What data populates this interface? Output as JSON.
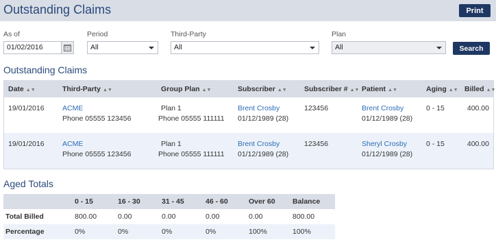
{
  "header": {
    "title": "Outstanding Claims",
    "print_label": "Print"
  },
  "filters": {
    "as_of": {
      "label": "As of",
      "value": "01/02/2016"
    },
    "period": {
      "label": "Period",
      "value": "All"
    },
    "third_party": {
      "label": "Third-Party",
      "value": "All"
    },
    "plan": {
      "label": "Plan",
      "value": "All"
    },
    "search_label": "Search"
  },
  "claims": {
    "title": "Outstanding Claims",
    "columns": [
      "Date",
      "Third-Party",
      "Group Plan",
      "Subscriber",
      "Subscriber #",
      "Patient",
      "Aging",
      "Billed"
    ],
    "rows": [
      {
        "date": "19/01/2016",
        "third_party": "ACME",
        "third_party_phone": "Phone 05555 123456",
        "group_plan": "Plan 1",
        "group_plan_phone": "Phone 05555 111111",
        "subscriber": "Brent Crosby",
        "subscriber_dob": "01/12/1989 (28)",
        "subscriber_no": "123456",
        "patient": "Brent Crosby",
        "patient_dob": "01/12/1989 (28)",
        "aging": "0 - 15",
        "billed": "400.00"
      },
      {
        "date": "19/01/2016",
        "third_party": "ACME",
        "third_party_phone": "Phone 05555 123456",
        "group_plan": "Plan 1",
        "group_plan_phone": "Phone 05555 111111",
        "subscriber": "Brent Crosby",
        "subscriber_dob": "01/12/1989 (28)",
        "subscriber_no": "123456",
        "patient": "Sheryl Crosby",
        "patient_dob": "01/12/1989 (28)",
        "aging": "0 - 15",
        "billed": "400.00"
      }
    ]
  },
  "aged_totals": {
    "title": "Aged Totals",
    "columns": [
      "",
      "0 - 15",
      "16 - 30",
      "31 - 45",
      "46 - 60",
      "Over 60",
      "Balance"
    ],
    "rows": [
      {
        "label": "Total Billed",
        "values": [
          "800.00",
          "0.00",
          "0.00",
          "0.00",
          "0.00",
          "800.00"
        ]
      },
      {
        "label": "Percentage",
        "values": [
          "0%",
          "0%",
          "0%",
          "0%",
          "100%",
          "100%"
        ]
      }
    ]
  },
  "icons": {
    "calendar": "calendar-icon",
    "dropdown": "chevron-down-icon",
    "sort": "sort-icon"
  },
  "colors": {
    "accent": "#1f3863",
    "header_bg": "#d9dde6",
    "link": "#2d6cb5",
    "alt_row": "#edf2fa",
    "title": "#2b4a7a"
  }
}
